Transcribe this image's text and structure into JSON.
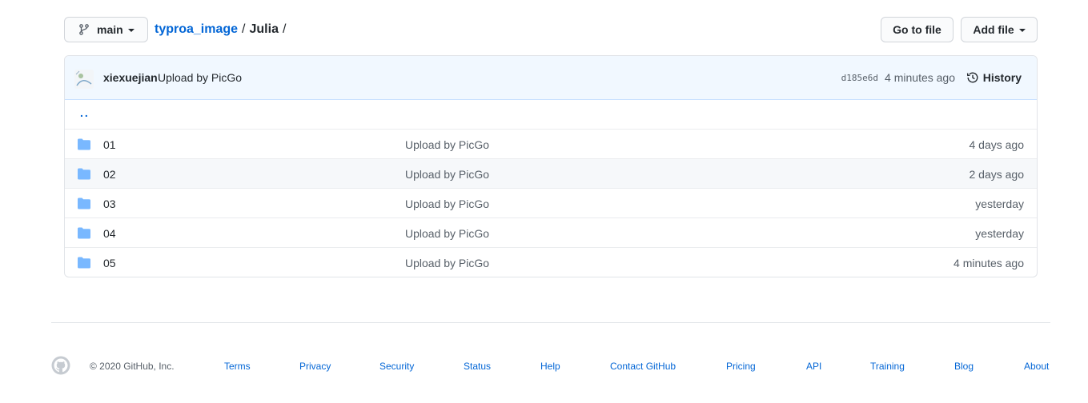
{
  "nav": {
    "branch_label": "main",
    "breadcrumb": {
      "repo": "typroa_image",
      "sep1": "/",
      "dir": "Julia",
      "sep2": "/"
    },
    "go_to_file_label": "Go to file",
    "add_file_label": "Add file"
  },
  "commit": {
    "author": "xiexuejian",
    "message": "Upload by PicGo",
    "sha": "d185e6d",
    "age": "4 minutes ago",
    "history_label": "History"
  },
  "files": {
    "up_label": "..",
    "rows": [
      {
        "name": "01",
        "message": "Upload by PicGo",
        "age": "4 days ago"
      },
      {
        "name": "02",
        "message": "Upload by PicGo",
        "age": "2 days ago"
      },
      {
        "name": "03",
        "message": "Upload by PicGo",
        "age": "yesterday"
      },
      {
        "name": "04",
        "message": "Upload by PicGo",
        "age": "yesterday"
      },
      {
        "name": "05",
        "message": "Upload by PicGo",
        "age": "4 minutes ago"
      }
    ]
  },
  "footer": {
    "copyright": "© 2020 GitHub, Inc.",
    "links": [
      "Terms",
      "Privacy",
      "Security",
      "Status",
      "Help",
      "Contact GitHub",
      "Pricing",
      "API",
      "Training",
      "Blog",
      "About"
    ]
  },
  "icons": {
    "branch": "git-branch-icon",
    "history": "history-clock-icon",
    "folder": "folder-icon",
    "logo": "github-logo-icon"
  },
  "colors": {
    "link": "#0366d6",
    "folder": "#79b8ff",
    "commit_bar_bg": "#f1f8ff",
    "muted": "#586069"
  }
}
